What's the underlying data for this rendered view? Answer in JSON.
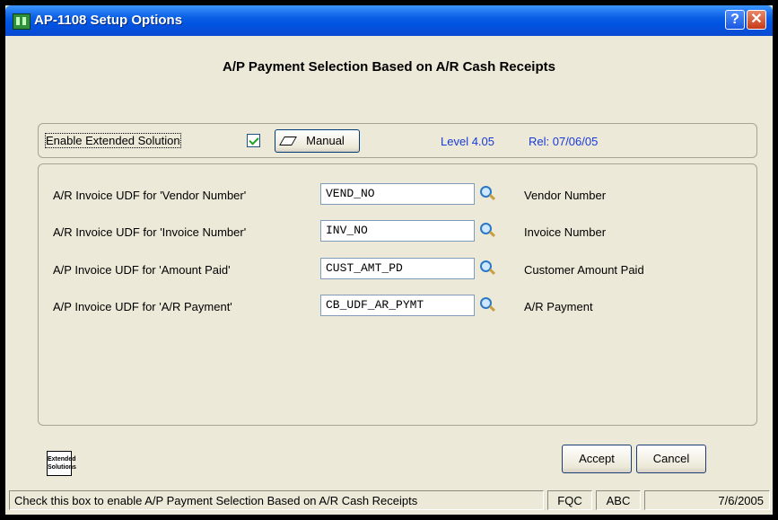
{
  "window": {
    "title": "AP-1108 Setup Options",
    "help_label": "?",
    "close_label": "✕"
  },
  "heading": "A/P Payment Selection Based on A/R Cash Receipts",
  "options": {
    "enable_label": "Enable Extended Solution",
    "enable_checked": true,
    "manual_label": "Manual",
    "level": "Level 4.05",
    "release": "Rel: 07/06/05"
  },
  "rows": [
    {
      "label": "A/R Invoice UDF for 'Vendor Number'",
      "value": "VEND_NO",
      "description": "Vendor Number"
    },
    {
      "label": "A/R Invoice UDF for 'Invoice Number'",
      "value": "INV_NO",
      "description": "Invoice Number"
    },
    {
      "label": "A/P Invoice UDF for 'Amount Paid'",
      "value": "CUST_AMT_PD",
      "description": "Customer Amount Paid"
    },
    {
      "label": "A/P Invoice UDF for 'A/R Payment'",
      "value": "CB_UDF_AR_PYMT",
      "description": "A/R Payment"
    }
  ],
  "logo": {
    "line1": "Extended",
    "line2": "Solutions"
  },
  "buttons": {
    "accept": "Accept",
    "cancel": "Cancel"
  },
  "status": {
    "message": "Check this box to enable A/P Payment Selection Based on A/R Cash Receipts",
    "company": "FQC",
    "user": "ABC",
    "date": "7/6/2005"
  },
  "icons": {
    "app": "app-icon",
    "lookup": "magnifier-icon",
    "manual": "book-icon"
  }
}
